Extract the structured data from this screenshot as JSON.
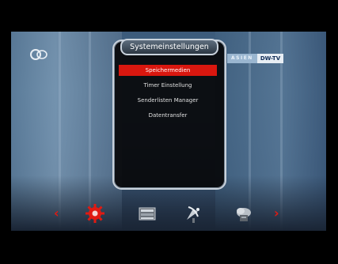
{
  "menu": {
    "title": "Systemeinstellungen",
    "items": [
      {
        "label": "Speichermedien",
        "selected": true
      },
      {
        "label": "Timer Einstellung",
        "selected": false
      },
      {
        "label": "Senderlisten Manager",
        "selected": false
      },
      {
        "label": "Datentransfer",
        "selected": false
      }
    ]
  },
  "channel": {
    "badge_left": "ASIEN",
    "badge_right": "DW-TV"
  },
  "navbar": {
    "left_arrow": "‹",
    "right_arrow": "›",
    "icons": [
      "gear-icon",
      "film-icon",
      "satellite-dish-icon",
      "cloud-icon"
    ]
  },
  "colors": {
    "accent": "#d9170f",
    "panel": "#08080a",
    "frame": "#c9d2dc"
  }
}
